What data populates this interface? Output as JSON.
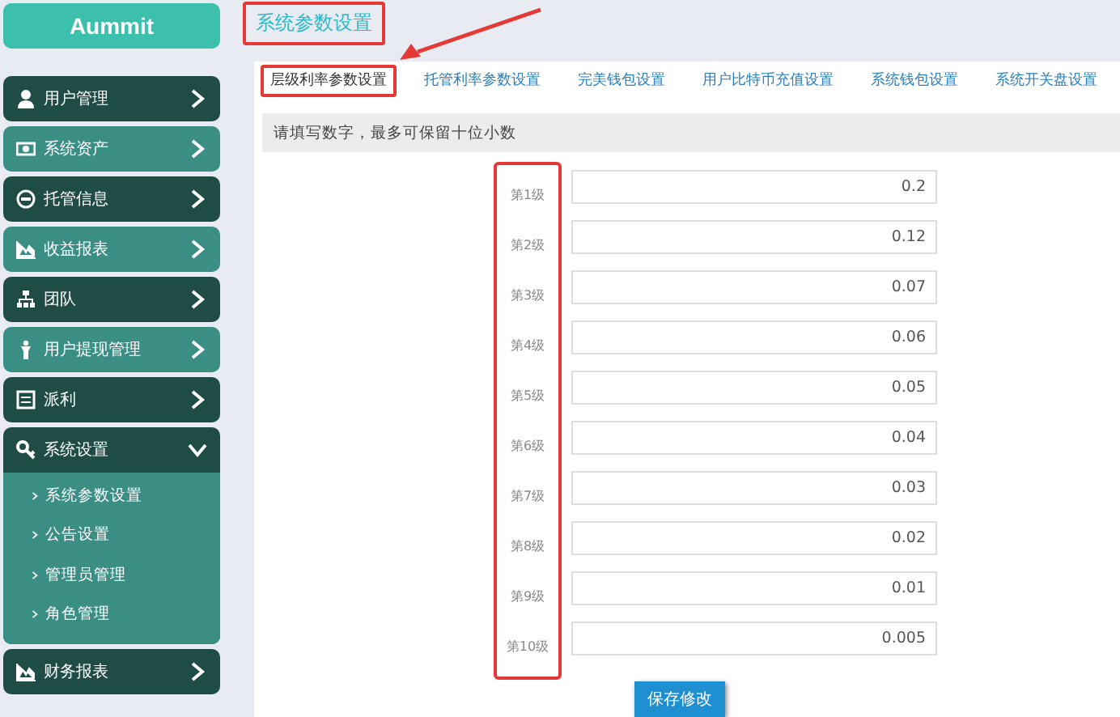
{
  "logo": "Aummit",
  "sidebar": {
    "items": [
      {
        "label": "用户管理",
        "kind": "user",
        "color": "#1f4d46",
        "expanded": false
      },
      {
        "label": "系统资产",
        "kind": "money",
        "color": "#3b8e84",
        "expanded": false
      },
      {
        "label": "托管信息",
        "kind": "coin",
        "color": "#1f4d46",
        "expanded": false
      },
      {
        "label": "收益报表",
        "kind": "chart",
        "color": "#3b8e84",
        "expanded": false
      },
      {
        "label": "团队",
        "kind": "org",
        "color": "#1f4d46",
        "expanded": false
      },
      {
        "label": "用户提现管理",
        "kind": "person",
        "color": "#3b8e84",
        "expanded": false
      },
      {
        "label": "派利",
        "kind": "list",
        "color": "#1f4d46",
        "expanded": false
      },
      {
        "label": "系统设置",
        "kind": "key",
        "color": "#1f4d46",
        "expanded": true,
        "children": [
          {
            "label": "系统参数设置"
          },
          {
            "label": "公告设置"
          },
          {
            "label": "管理员管理"
          },
          {
            "label": "角色管理"
          }
        ]
      },
      {
        "label": "财务报表",
        "kind": "chart",
        "color": "#1f4d46",
        "expanded": false
      }
    ]
  },
  "page_title": {
    "text": "系统参数设置",
    "highlighted": true
  },
  "tabs": [
    {
      "label": "层级利率参数设置",
      "selected": true,
      "highlighted": true
    },
    {
      "label": "托管利率参数设置",
      "selected": false,
      "highlighted": false
    },
    {
      "label": "完美钱包设置",
      "selected": false,
      "highlighted": false
    },
    {
      "label": "用户比特币充值设置",
      "selected": false,
      "highlighted": false
    },
    {
      "label": "系统钱包设置",
      "selected": false,
      "highlighted": false
    },
    {
      "label": "系统开关盘设置",
      "selected": false,
      "highlighted": false
    }
  ],
  "notice": "请填写数字，最多可保留十位小数",
  "levels": {
    "highlighted": true,
    "rows": [
      {
        "label": "第1级",
        "value": "0.2"
      },
      {
        "label": "第2级",
        "value": "0.12"
      },
      {
        "label": "第3级",
        "value": "0.07"
      },
      {
        "label": "第4级",
        "value": "0.06"
      },
      {
        "label": "第5级",
        "value": "0.05"
      },
      {
        "label": "第6级",
        "value": "0.04"
      },
      {
        "label": "第7级",
        "value": "0.03"
      },
      {
        "label": "第8级",
        "value": "0.02"
      },
      {
        "label": "第9级",
        "value": "0.01"
      },
      {
        "label": "第10级",
        "value": "0.005"
      }
    ]
  },
  "save_button": "保存修改"
}
